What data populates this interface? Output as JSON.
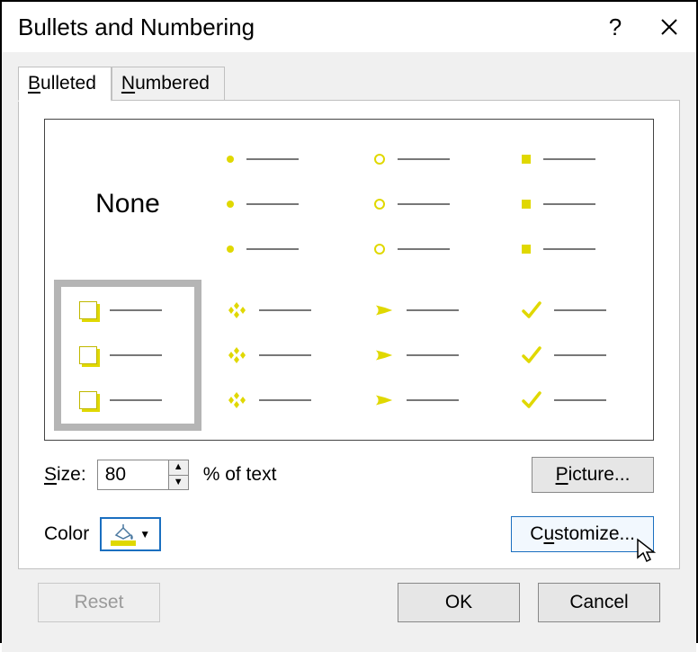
{
  "dialog": {
    "title": "Bullets and Numbering",
    "help": "?",
    "close": "✕"
  },
  "tabs": {
    "bulleted": {
      "accel": "B",
      "rest": "ulleted",
      "active": true
    },
    "numbered": {
      "accel": "N",
      "rest": "umbered",
      "active": false
    }
  },
  "gallery": {
    "items": [
      {
        "kind": "none",
        "label": "None",
        "selected": false
      },
      {
        "kind": "dot",
        "selected": false
      },
      {
        "kind": "ring",
        "selected": false
      },
      {
        "kind": "sq",
        "selected": false
      },
      {
        "kind": "box",
        "selected": true
      },
      {
        "kind": "diamond4",
        "selected": false
      },
      {
        "kind": "arrow",
        "selected": false
      },
      {
        "kind": "check",
        "selected": false
      }
    ]
  },
  "size": {
    "label_accel": "S",
    "label_rest": "ize:",
    "value": "80",
    "suffix": "% of text"
  },
  "color": {
    "label": "Color",
    "swatch_hex": "#e0d800"
  },
  "buttons": {
    "picture": {
      "accel": "P",
      "rest": "icture...",
      "mid": ""
    },
    "customize": {
      "pre": "C",
      "accel": "u",
      "rest": "stomize..."
    },
    "reset": {
      "label": "Reset",
      "enabled": false
    },
    "ok": "OK",
    "cancel": "Cancel"
  }
}
